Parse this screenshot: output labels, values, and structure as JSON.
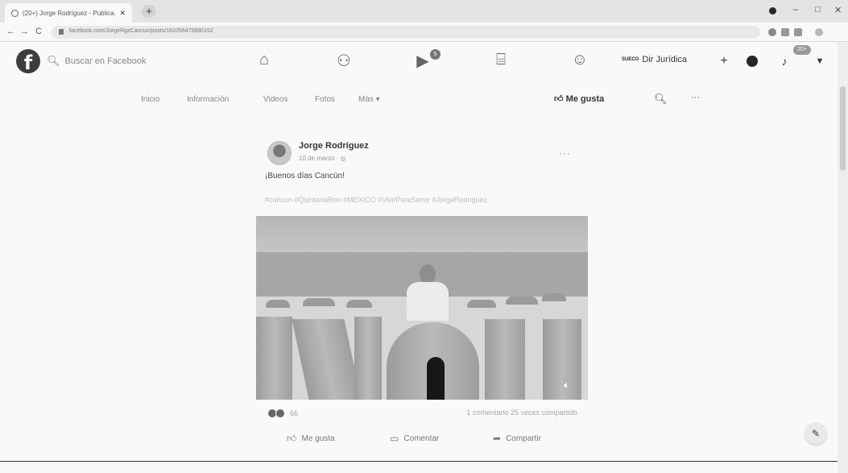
{
  "browser": {
    "tab_title": "(20+) Jorge Rodríguez - Publica...",
    "tab_close": "✕",
    "new_tab": "+",
    "url": "facebook.com/JorgeRgzCancun/posts/161056475890152",
    "min": "–",
    "max": "□",
    "close": "✕",
    "back": "←",
    "forward": "→",
    "reload": "C"
  },
  "fb_nav": {
    "logo": "f",
    "search_placeholder": "Buscar en Facebook",
    "watch_badge": "5",
    "account_mini": "SUECO",
    "account_name": "Dir Jurídica",
    "plus": "+",
    "notif_badge": "20+"
  },
  "page_tabs": {
    "items": [
      "Inicio",
      "Información",
      "Videos",
      "Fotos",
      "Más ▾"
    ],
    "like_label": "Me gusta",
    "more": "···"
  },
  "post": {
    "author": "Jorge Rodríguez",
    "date": "10 de marzo · ",
    "options": "···",
    "text": "¡Buenos días Cancún!",
    "hashtags": "#cancun #QuintanaRoo #MEXICO #VivirParaServir #JorgeRodriguez",
    "reaction_count": "66",
    "comments_shares": "1 comentario  25 veces compartido",
    "actions": {
      "like": "Me gusta",
      "comment": "Comentar",
      "share": "Compartir"
    }
  },
  "icons": {
    "home": "home-icon",
    "friends": "friends-icon",
    "watch": "watch-icon",
    "marketplace": "marketplace-icon",
    "groups": "groups-icon",
    "messenger": "messenger-icon",
    "bell": "bell-icon",
    "edit": "edit-icon"
  }
}
